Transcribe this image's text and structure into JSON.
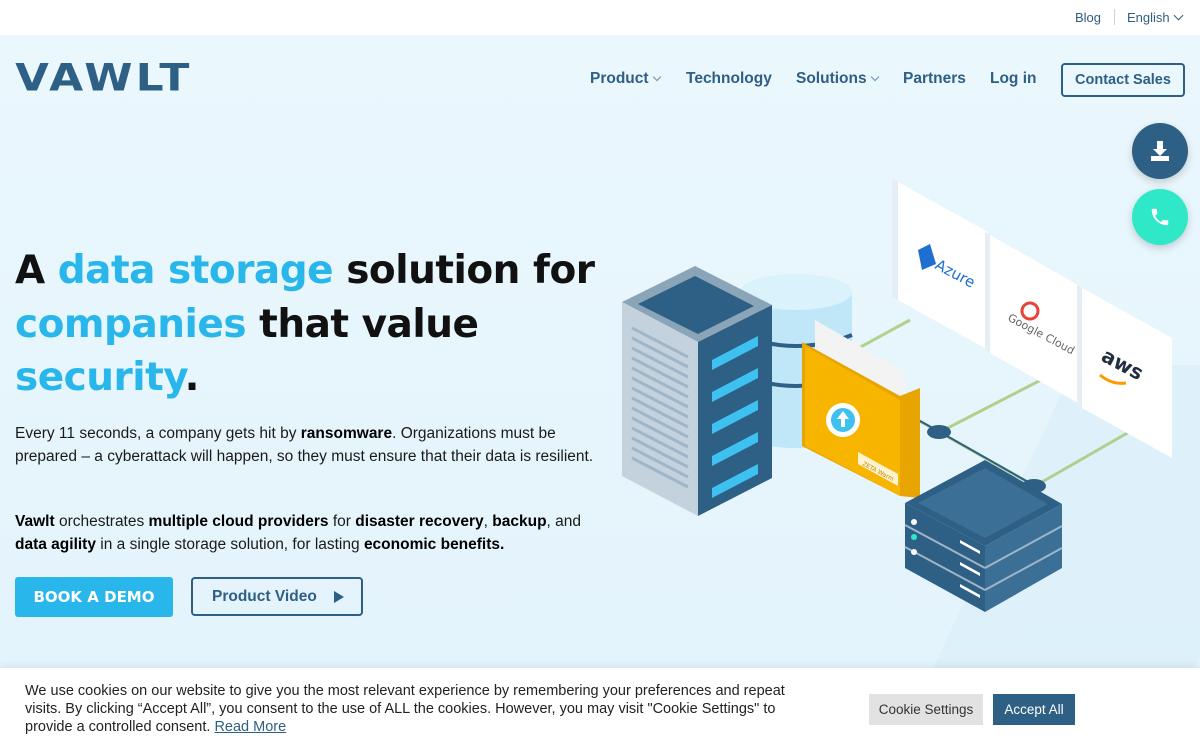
{
  "topbar": {
    "blog": "Blog",
    "language": "English"
  },
  "brand": {
    "logo": "VAWLT"
  },
  "nav": {
    "items": [
      {
        "label": "Product",
        "dropdown": true
      },
      {
        "label": "Technology",
        "dropdown": false
      },
      {
        "label": "Solutions",
        "dropdown": true
      },
      {
        "label": "Partners",
        "dropdown": false
      },
      {
        "label": "Log in",
        "dropdown": false
      }
    ],
    "contact": "Contact Sales"
  },
  "floating": {
    "download_icon": "download-icon",
    "phone_icon": "phone-icon"
  },
  "hero": {
    "headline": {
      "a": "A",
      "hl1": "data storage",
      "b": "solution for",
      "hl2": "companies",
      "c": "that value",
      "hl3": "security",
      "d": "."
    },
    "p1": {
      "t1": "Every 11 seconds, a company gets hit by ",
      "b1": "ransomware",
      "t2": ". Organizations must be prepared – a cyberattack will happen, so they must ensure that their data is resilient."
    },
    "p2": {
      "b1": "Vawlt",
      "t1": " orchestrates ",
      "b2": "multiple cloud providers",
      "t2": " for ",
      "b3": "disaster recovery",
      "t3": ", ",
      "b4": "backup",
      "t4": ", and ",
      "b5": "data agility",
      "t5": " in a single storage solution, for lasting ",
      "b6": "economic benefits."
    },
    "cta_demo": "BOOK A DEMO",
    "cta_video": "Product Video"
  },
  "illustration": {
    "providers": [
      "Azure",
      "Google Cloud",
      "aws"
    ],
    "file_tag": "ZETA Warm"
  },
  "cookie": {
    "text": "We use cookies on our website to give you the most relevant experience by remembering your preferences and repeat visits. By clicking “Accept All”, you consent to the use of ALL the cookies. However, you may visit \"Cookie Settings\" to provide a controlled consent.",
    "read_more": "Read More",
    "settings": "Cookie Settings",
    "accept": "Accept All"
  },
  "colors": {
    "brand": "#2e5f84",
    "accent": "#29b6ea",
    "teal": "#2ee8c7",
    "hero_bg": "#e8f6fd"
  }
}
